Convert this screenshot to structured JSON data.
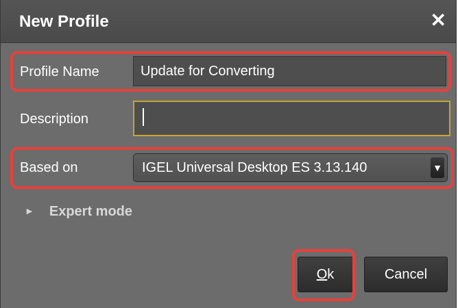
{
  "dialog": {
    "title": "New Profile",
    "close_glyph": "✕"
  },
  "form": {
    "profile_name_label": "Profile Name",
    "profile_name_value": "Update for Converting",
    "description_label": "Description",
    "description_value": "",
    "based_on_label": "Based on",
    "based_on_value": "IGEL Universal Desktop ES 3.13.140",
    "dropdown_arrow": "▼"
  },
  "expert": {
    "arrow": "►",
    "label": "Expert mode"
  },
  "buttons": {
    "ok_mnemonic": "O",
    "ok_rest": "k",
    "cancel_label": "Cancel"
  },
  "colors": {
    "dialog_bg": "#6c6c6c",
    "titlebar_bg": "#4a4a4a",
    "highlight": "#e8403c",
    "focus_border": "#c7a532"
  },
  "icons": {
    "close": "close-icon",
    "dropdown": "chevron-down-icon",
    "expand": "expand-triangle-icon"
  }
}
